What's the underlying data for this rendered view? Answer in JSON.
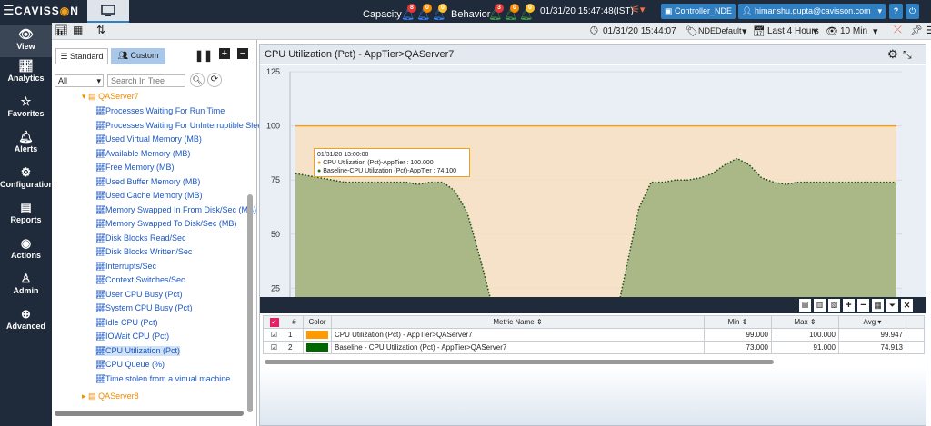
{
  "topbar": {
    "logo": "CAVISS",
    "logo_tail": "N",
    "capacity_label": "Capacity",
    "capacity_badges": [
      "8",
      "0",
      "0"
    ],
    "behavior_label": "Behavior",
    "behavior_badges": [
      "3",
      "0",
      "0"
    ],
    "datetime": "01/31/20 15:47:48(IST)",
    "controller": "Controller_NDE",
    "user": "himanshu.gupta@cavisson.com",
    "help": "?"
  },
  "toolbar2": {
    "datetime": "01/31/20 15:44:07",
    "profile": "NDEDefault",
    "range": "Last 4 Hours",
    "interval": "10 Min"
  },
  "leftnav": [
    "View",
    "Analytics",
    "Favorites",
    "Alerts",
    "Configuration",
    "Reports",
    "Actions",
    "Admin",
    "Advanced"
  ],
  "tree": {
    "tab_standard": "Standard",
    "tab_custom": "Custom",
    "filter_value": "All",
    "search_placeholder": "Search In Tree",
    "parent_node": "QAServer7",
    "next_node": "QAServer8",
    "items": [
      "Processes Waiting For Run Time",
      "Processes Waiting For UnInterruptible Slee",
      "Used Virtual Memory (MB)",
      "Available Memory (MB)",
      "Free Memory (MB)",
      "Used Buffer Memory (MB)",
      "Used Cache Memory (MB)",
      "Memory Swapped In From Disk/Sec (MB)",
      "Memory Swapped To Disk/Sec (MB)",
      "Disk Blocks Read/Sec",
      "Disk Blocks Written/Sec",
      "Interrupts/Sec",
      "Context Switches/Sec",
      "User CPU Busy (Pct)",
      "System CPU Busy (Pct)",
      "Idle CPU (Pct)",
      "IOWait CPU (Pct)",
      "CPU Utilization (Pct)",
      "CPU Queue (%)",
      "Time stolen from a virtual machine"
    ]
  },
  "panel": {
    "title": "CPU Utilization (Pct) - AppTier>QAServer7"
  },
  "chart_data": {
    "type": "area",
    "y_ticks": [
      "125",
      "100",
      "75",
      "50",
      "25"
    ],
    "ylim": [
      0,
      125
    ],
    "series": [
      {
        "name": "CPU Utilization (Pct) - AppTier>QAServer7",
        "color": "#f0a020",
        "values": [
          100,
          100,
          100,
          100,
          100,
          100,
          100,
          100,
          100,
          100,
          100,
          100,
          100,
          100,
          100,
          100,
          100,
          100,
          100,
          100,
          100,
          100,
          100,
          100,
          100,
          100,
          100,
          100,
          100,
          100,
          100,
          100,
          100,
          100,
          100,
          100,
          100,
          100,
          100,
          100,
          100,
          100,
          100,
          100,
          100,
          100,
          100,
          100,
          100,
          100
        ]
      },
      {
        "name": "Baseline - CPU Utilization (Pct) - AppTier>QAServer7",
        "color": "#1a6e1a",
        "values": [
          78,
          77,
          76,
          75,
          74,
          74,
          74,
          74,
          74,
          74,
          73,
          74,
          74,
          70,
          60,
          40,
          18,
          0,
          0,
          0,
          0,
          0,
          0,
          0,
          0,
          0,
          8,
          35,
          62,
          74,
          74,
          75,
          75,
          76,
          78,
          82,
          85,
          82,
          76,
          74,
          73,
          74,
          74,
          74,
          74,
          74,
          74,
          74,
          74,
          74
        ]
      }
    ],
    "tooltip": {
      "time": "01/31/20 13:00:00",
      "line1": "CPU Utilization (Pct)-AppTier : 100.000",
      "line2": "Baseline-CPU Utilization (Pct)-AppTier : 74.100"
    }
  },
  "legend_table": {
    "headers": [
      "#",
      "Color",
      "Metric Name",
      "Min",
      "Max",
      "Avg"
    ],
    "rows": [
      {
        "num": "1",
        "color": "#ff9900",
        "name": "CPU Utilization (Pct) - AppTier>QAServer7",
        "min": "99.000",
        "max": "100.000",
        "avg": "99.947"
      },
      {
        "num": "2",
        "color": "#006600",
        "name": "Baseline - CPU Utilization (Pct) - AppTier>QAServer7",
        "min": "73.000",
        "max": "91.000",
        "avg": "74.913"
      }
    ]
  }
}
